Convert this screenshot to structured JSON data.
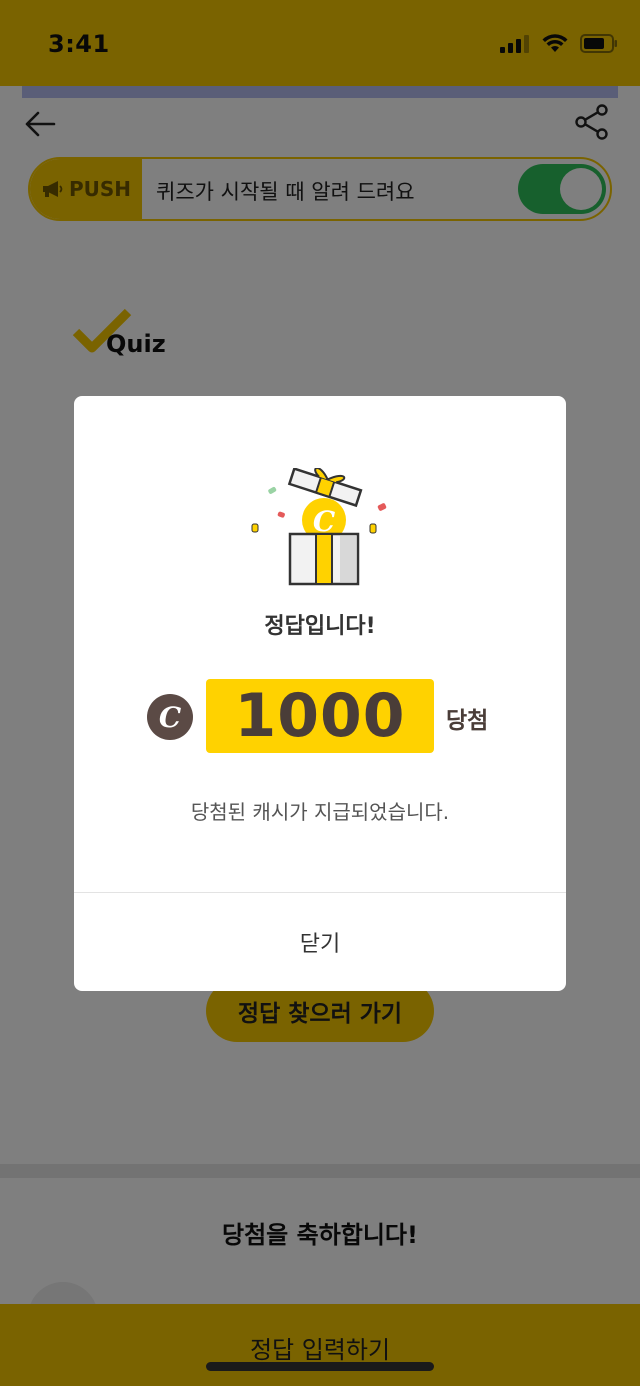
{
  "status_bar": {
    "time": "3:41"
  },
  "push": {
    "label": "PUSH",
    "message": "퀴즈가 시작될 때 알려 드려요",
    "enabled": true
  },
  "quiz_logo": {
    "text": "Quiz"
  },
  "find_answer": {
    "label": "정답 찾으러 가기"
  },
  "congrats": {
    "title": "당첨을 축하합니다!"
  },
  "submit": {
    "label": "정답 입력하기"
  },
  "dialog": {
    "title": "정답입니다!",
    "coin_letter": "C",
    "amount": "1000",
    "amount_suffix": "당첨",
    "message": "당첨된 캐시가 지급되었습니다.",
    "close_label": "닫기"
  },
  "colors": {
    "brand_yellow": "#f5c700",
    "prize_yellow": "#ffd200",
    "toggle_green": "#2fc05a",
    "coin_brown": "#5b4a45"
  }
}
